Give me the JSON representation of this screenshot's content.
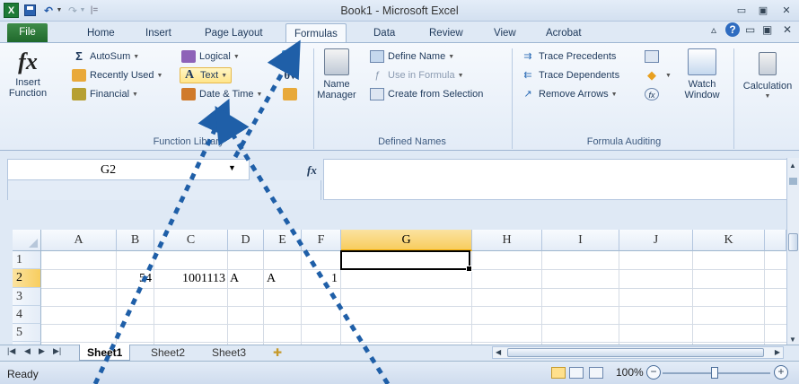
{
  "window": {
    "title": "Book1 - Microsoft Excel",
    "app_icon_label": "X"
  },
  "quick_access": {
    "separator": "|="
  },
  "tabs": {
    "file": "File",
    "home": "Home",
    "insert": "Insert",
    "page_layout": "Page Layout",
    "formulas": "Formulas",
    "data": "Data",
    "review": "Review",
    "view": "View",
    "acrobat": "Acrobat"
  },
  "ribbon": {
    "function_library": {
      "insert_function_icon": "fx",
      "insert_function": "Insert Function",
      "autosum": "AutoSum",
      "autosum_icon": "Σ",
      "recently_used": "Recently Used",
      "financial": "Financial",
      "logical": "Logical",
      "text": "Text",
      "date_time": "Date & Time",
      "label": "Function Library"
    },
    "defined_names": {
      "name_manager": "Name Manager",
      "define_name": "Define Name",
      "use_in_formula": "Use in Formula",
      "create_from_selection": "Create from Selection",
      "label": "Defined Names"
    },
    "formula_auditing": {
      "trace_precedents": "Trace Precedents",
      "trace_dependents": "Trace Dependents",
      "remove_arrows": "Remove Arrows",
      "watch_window": "Watch Window",
      "label": "Formula Auditing"
    },
    "calculation": {
      "calculation": "Calculation"
    }
  },
  "formula_bar": {
    "name_box": "G2",
    "fx_label": "fx",
    "formula": ""
  },
  "grid": {
    "columns": [
      "A",
      "B",
      "C",
      "D",
      "E",
      "F",
      "G",
      "H",
      "I",
      "J",
      "K"
    ],
    "rows": [
      "1",
      "2",
      "3",
      "4",
      "5"
    ],
    "selected_column": "G",
    "selected_row": "2",
    "cells": {
      "B2": "54",
      "C2": "1001113",
      "D2": "A",
      "E2": "A",
      "F2": "1"
    }
  },
  "sheets": {
    "tabs": [
      "Sheet1",
      "Sheet2",
      "Sheet3"
    ],
    "active": "Sheet1"
  },
  "status_bar": {
    "status": "Ready",
    "zoom": "100%"
  },
  "colors": {
    "file_tab": "#2e7d3a",
    "selection_header": "#f8cd5e",
    "arrow": "#1f5fa8"
  },
  "annotations": {
    "type": "dashed arrows pointing up from the bottom toward the Text function button and the Formulas tab"
  }
}
